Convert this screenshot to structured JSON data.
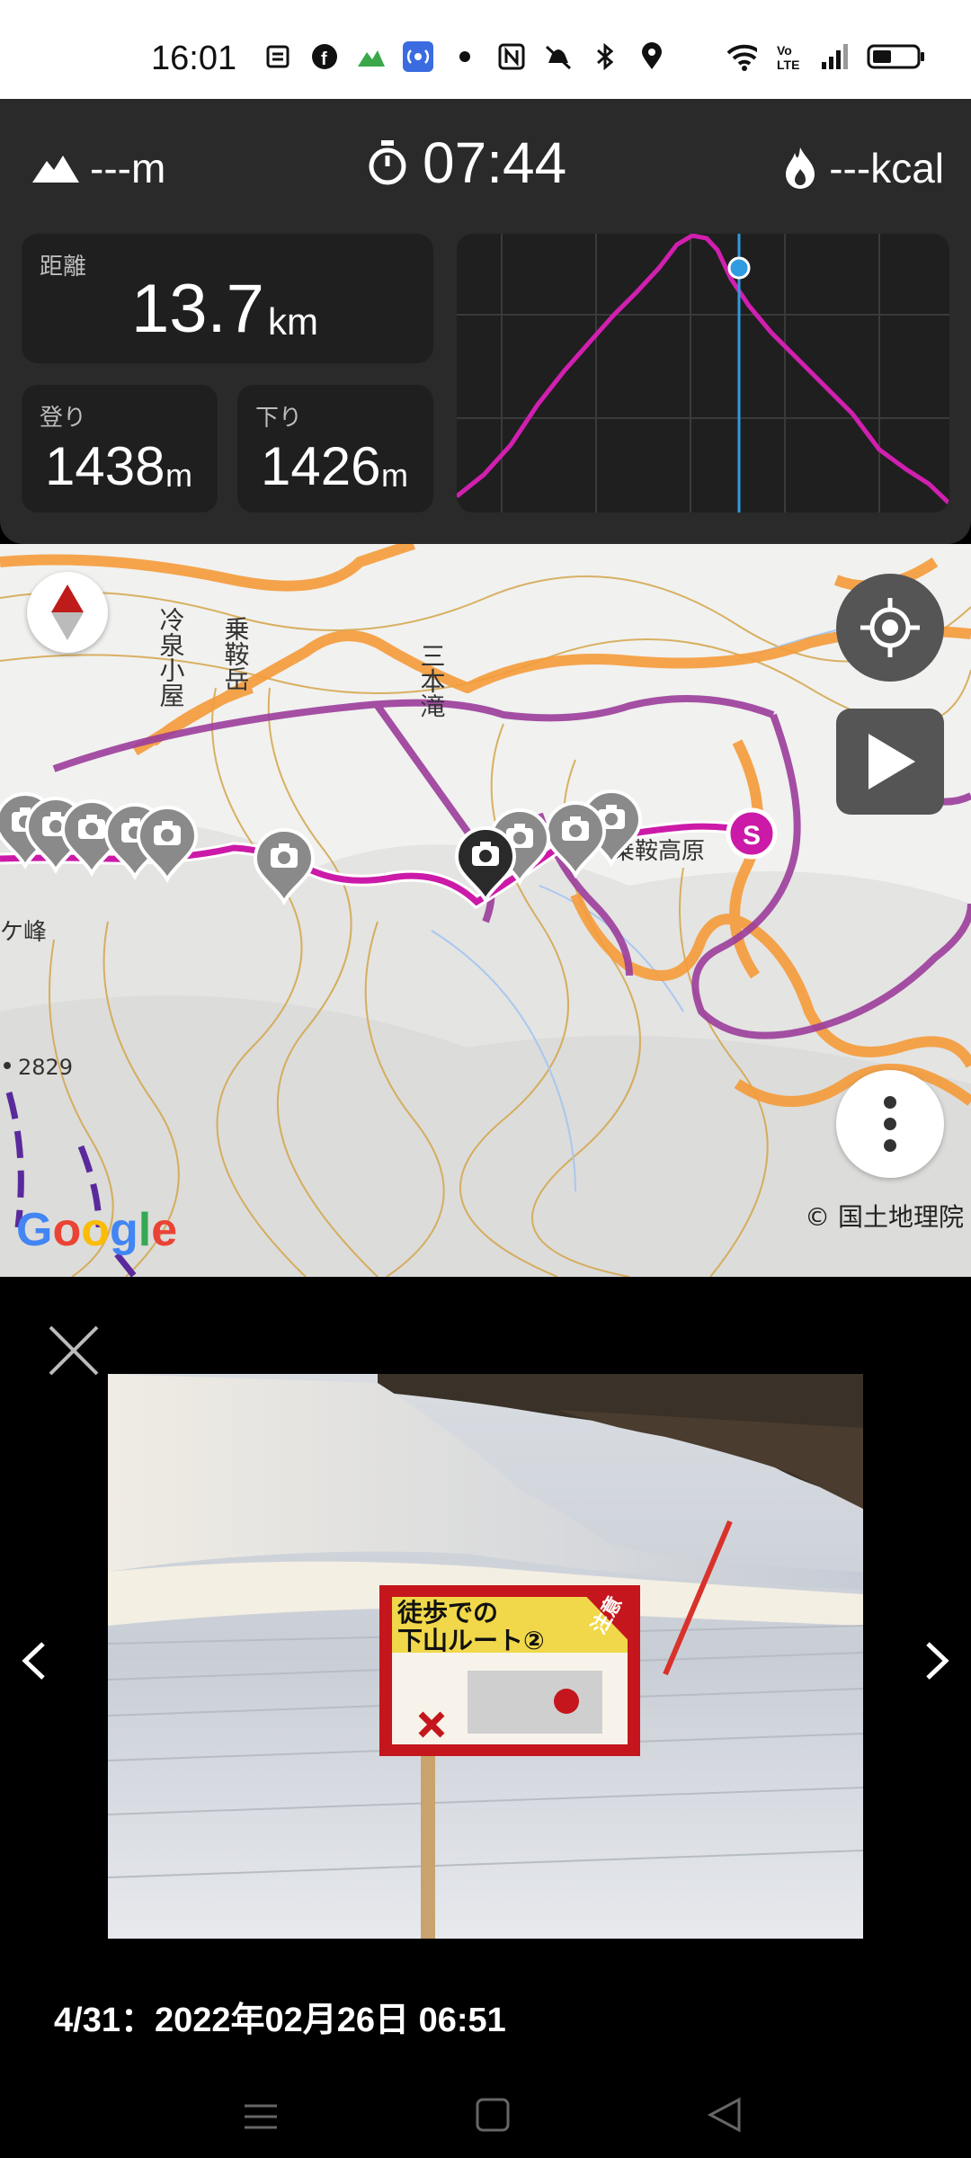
{
  "status_bar": {
    "time": "16:01",
    "left_icons": [
      "news-icon",
      "facebook-icon",
      "yamap-icon",
      "nearby-icon",
      "dot-icon",
      "nfc-icon",
      "mute-icon",
      "bluetooth-icon",
      "location-icon"
    ],
    "right_icons": [
      "wifi-icon",
      "volte-icon",
      "signal-icon",
      "battery-icon"
    ]
  },
  "stats_header": {
    "altitude": "---m",
    "elapsed_time": "07:44",
    "calories": "---kcal"
  },
  "stats": {
    "distance_label": "距離",
    "distance_value": "13.7",
    "distance_unit": "km",
    "ascent_label": "登り",
    "ascent_value": "1438",
    "ascent_unit": "m",
    "descent_label": "下り",
    "descent_value": "1426",
    "descent_unit": "m"
  },
  "elevation_chart": {
    "colors": {
      "line": "#d11fb0",
      "marker": "#2f9be0",
      "background": "#1f1f1f",
      "grid": "#3a3a3a"
    }
  },
  "map": {
    "labels": {
      "hut": "冷泉小屋",
      "peak": "乗鞍岳",
      "waterfall": "三本滝",
      "plateau": "乗鞍高原",
      "ridge": "ケ峰",
      "elevation": "2829"
    },
    "start_marker": "S",
    "attribution": "© 国土地理院",
    "logo": "Google",
    "colors": {
      "track": "#cc1aa8",
      "route_orange": "#f59b3a",
      "route_purple": "#9b3d9b",
      "contour": "#d4a54a"
    }
  },
  "photo_viewer": {
    "caption": "4/31：2022年02月26日 06:51",
    "sign_text_line1": "徒歩での",
    "sign_text_line2": "下山ルート②",
    "sign_badge": "注意"
  }
}
